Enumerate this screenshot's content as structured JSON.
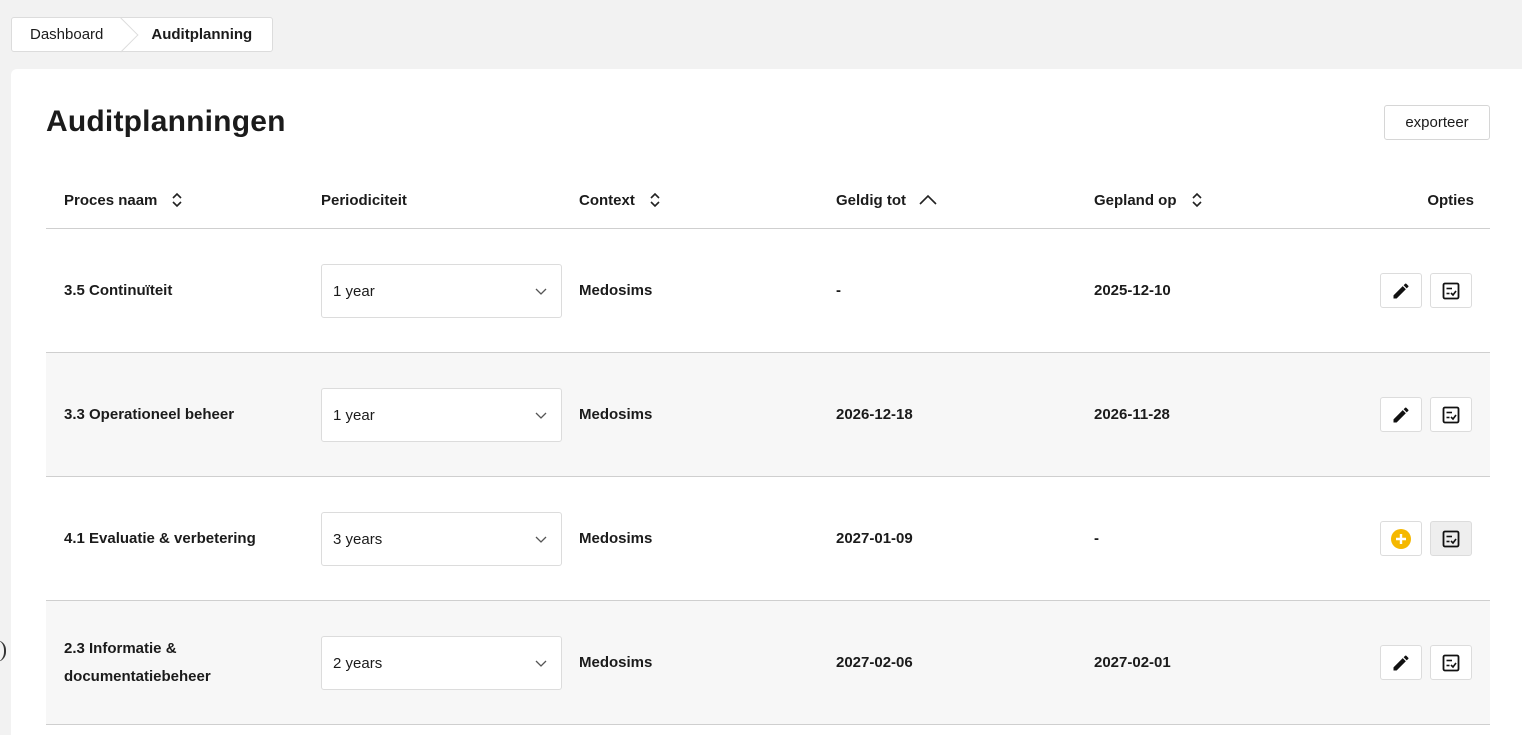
{
  "breadcrumb": {
    "items": [
      "Dashboard",
      "Auditplanning"
    ]
  },
  "page": {
    "title": "Auditplanningen",
    "export_label": "exporteer"
  },
  "table": {
    "columns": {
      "proces": "Proces naam",
      "periodiciteit": "Periodiciteit",
      "context": "Context",
      "geldig": "Geldig tot",
      "gepland": "Gepland op",
      "opties": "Opties"
    },
    "sorted_column": "geldig",
    "sort_direction": "ascending",
    "rows": [
      {
        "proces_line1": "3.5 Continuïteit",
        "proces_line2": "",
        "periodiciteit": "1 year",
        "context": "Medosims",
        "geldig": "-",
        "gepland": "2025-12-10",
        "primary_action": "edit-icon"
      },
      {
        "proces_line1": "3.3 Operationeel beheer",
        "proces_line2": "",
        "periodiciteit": "1 year",
        "context": "Medosims",
        "geldig": "2026-12-18",
        "gepland": "2026-11-28",
        "primary_action": "edit-icon"
      },
      {
        "proces_line1": "4.1 Evaluatie & verbetering",
        "proces_line2": "",
        "periodiciteit": "3 years",
        "context": "Medosims",
        "geldig": "2027-01-09",
        "gepland": "-",
        "primary_action": "add-circle-icon"
      },
      {
        "proces_line1": "2.3 Informatie &",
        "proces_line2": "documentatiebeheer",
        "periodiciteit": "2 years",
        "context": "Medosims",
        "geldig": "2027-02-06",
        "gepland": "2027-02-01",
        "primary_action": "edit-icon"
      }
    ]
  },
  "colors": {
    "background": "#f2f2f2",
    "card": "#ffffff",
    "row_alt": "#f7f7f7",
    "accent_add": "#f5b800",
    "text": "#1b1b1b"
  }
}
